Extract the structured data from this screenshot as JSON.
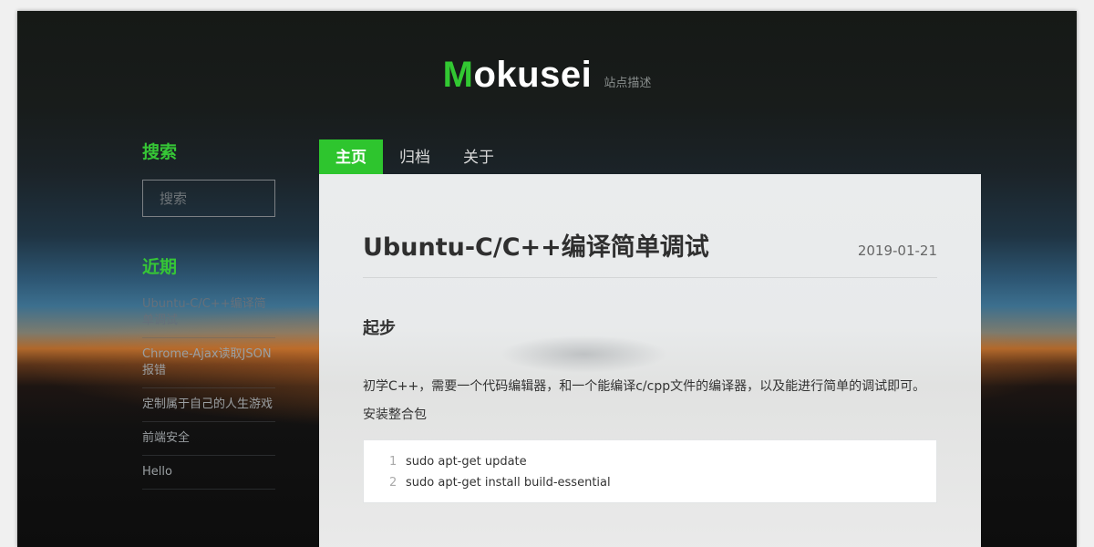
{
  "header": {
    "logo_first": "M",
    "logo_rest": "okusei",
    "tagline": "站点描述"
  },
  "sidebar": {
    "search_heading": "搜索",
    "search_placeholder": "搜索",
    "recent_heading": "近期",
    "recent": [
      "Ubuntu-C/C++编译简单调试",
      "Chrome-Ajax读取JSON报错",
      "定制属于自己的人生游戏",
      "前端安全",
      "Hello"
    ]
  },
  "tabs": [
    {
      "label": "主页",
      "active": true
    },
    {
      "label": "归档",
      "active": false
    },
    {
      "label": "关于",
      "active": false
    }
  ],
  "post": {
    "title": "Ubuntu-C/C++编译简单调试",
    "date": "2019-01-21",
    "section": "起步",
    "paragraph": "初学C++，需要一个代码编辑器，和一个能编译c/cpp文件的编译器，以及能进行简单的调试即可。",
    "paragraph2": "安装整合包",
    "code": [
      {
        "num": "1",
        "text": "sudo apt-get update"
      },
      {
        "num": "2",
        "text": "sudo apt-get install build-essential"
      }
    ]
  },
  "colors": {
    "accent": "#2ec52e",
    "page_bg": "#111111"
  }
}
